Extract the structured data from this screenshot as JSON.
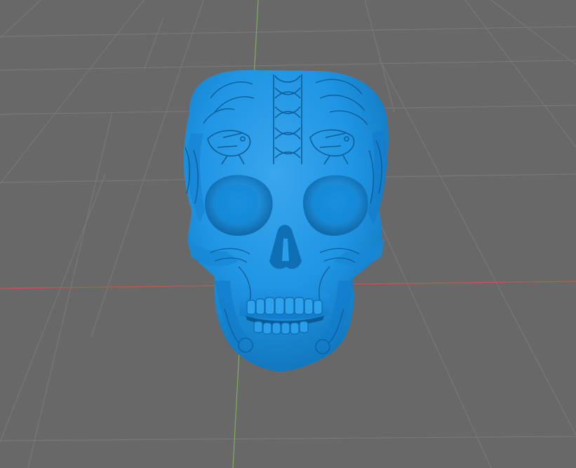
{
  "viewport": {
    "background_color": "#686868",
    "grid_color": "#7a7a7a",
    "x_axis_color": "#c4574f",
    "y_axis_color": "#7fae5a"
  },
  "model": {
    "name": "skull-model",
    "color": "#1f95e3",
    "shadow_color": "#0f6fb4",
    "highlight_color": "#47aff0",
    "engraving_color": "#0b5e99"
  }
}
